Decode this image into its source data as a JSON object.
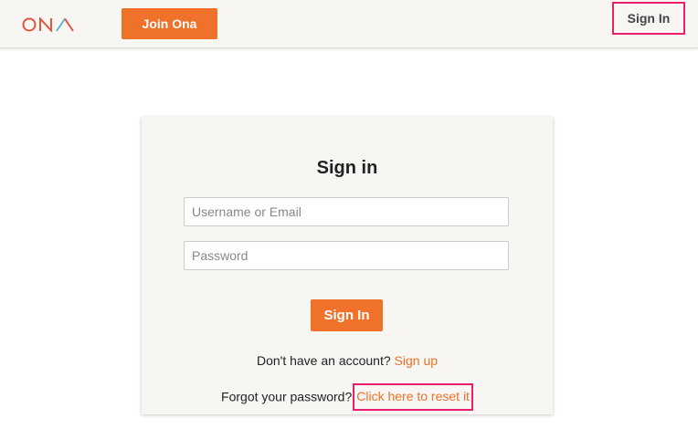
{
  "header": {
    "logo_text": "ONA",
    "join_label": "Join Ona",
    "signin_label": "Sign In"
  },
  "card": {
    "title": "Sign in",
    "username_placeholder": "Username or Email",
    "password_placeholder": "Password",
    "submit_label": "Sign In",
    "no_account_text": "Don't have an account?",
    "signup_link": "Sign up",
    "forgot_text": "Forgot your password?",
    "reset_link": "Click here to reset it"
  },
  "colors": {
    "accent": "#f0712a",
    "highlight": "#ec1f6c",
    "logo_blue": "#5bb8c9"
  }
}
